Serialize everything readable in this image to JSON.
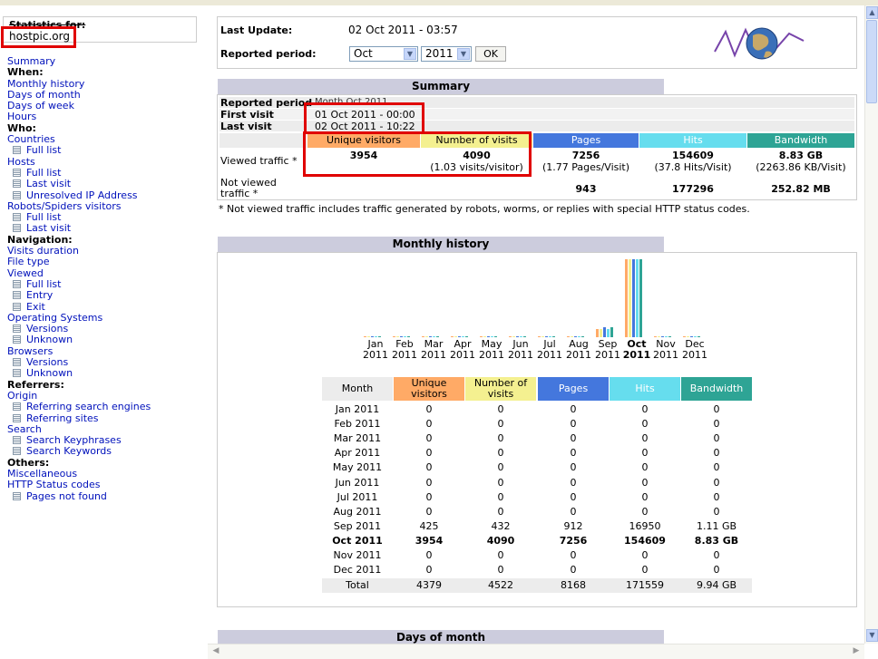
{
  "sidebar": {
    "stats_label": "Statistics for:",
    "site": "hostpic.org",
    "menu": [
      {
        "t": "link",
        "label": "Summary"
      },
      {
        "t": "head",
        "label": "When:"
      },
      {
        "t": "link",
        "label": "Monthly history"
      },
      {
        "t": "link",
        "label": "Days of month"
      },
      {
        "t": "link",
        "label": "Days of week"
      },
      {
        "t": "link",
        "label": "Hours"
      },
      {
        "t": "head",
        "label": "Who:"
      },
      {
        "t": "link",
        "label": "Countries"
      },
      {
        "t": "sub",
        "label": "Full list"
      },
      {
        "t": "link",
        "label": "Hosts"
      },
      {
        "t": "sub",
        "label": "Full list"
      },
      {
        "t": "sub",
        "label": "Last visit"
      },
      {
        "t": "sub",
        "label": "Unresolved IP Address"
      },
      {
        "t": "link",
        "label": "Robots/Spiders visitors"
      },
      {
        "t": "sub",
        "label": "Full list"
      },
      {
        "t": "sub",
        "label": "Last visit"
      },
      {
        "t": "head",
        "label": "Navigation:"
      },
      {
        "t": "link",
        "label": "Visits duration"
      },
      {
        "t": "link",
        "label": "File type"
      },
      {
        "t": "link",
        "label": "Viewed"
      },
      {
        "t": "sub",
        "label": "Full list"
      },
      {
        "t": "sub",
        "label": "Entry"
      },
      {
        "t": "sub",
        "label": "Exit"
      },
      {
        "t": "link",
        "label": "Operating Systems"
      },
      {
        "t": "sub",
        "label": "Versions"
      },
      {
        "t": "sub",
        "label": "Unknown"
      },
      {
        "t": "link",
        "label": "Browsers"
      },
      {
        "t": "sub",
        "label": "Versions"
      },
      {
        "t": "sub",
        "label": "Unknown"
      },
      {
        "t": "head",
        "label": "Referrers:"
      },
      {
        "t": "link",
        "label": "Origin"
      },
      {
        "t": "sub",
        "label": "Referring search engines"
      },
      {
        "t": "sub",
        "label": "Referring sites"
      },
      {
        "t": "link",
        "label": "Search"
      },
      {
        "t": "sub",
        "label": "Search Keyphrases"
      },
      {
        "t": "sub",
        "label": "Search Keywords"
      },
      {
        "t": "head",
        "label": "Others:"
      },
      {
        "t": "link",
        "label": "Miscellaneous"
      },
      {
        "t": "link",
        "label": "HTTP Status codes"
      },
      {
        "t": "sub",
        "label": "Pages not found"
      }
    ]
  },
  "header": {
    "last_update_label": "Last Update:",
    "last_update_value": "02 Oct 2011 - 03:57",
    "period_label": "Reported period:",
    "month_value": "Oct",
    "year_value": "2011",
    "ok_label": "OK"
  },
  "summary": {
    "title": "Summary",
    "reported_period_label": "Reported period",
    "reported_period_value": "Month Oct 2011",
    "first_visit_label": "First visit",
    "first_visit_value": "01 Oct 2011 - 00:00",
    "last_visit_label": "Last visit",
    "last_visit_value": "02 Oct 2011 - 10:22",
    "columns": [
      "Unique visitors",
      "Number of visits",
      "Pages",
      "Hits",
      "Bandwidth"
    ],
    "viewed_label": "Viewed traffic *",
    "viewed": {
      "unique": "3954",
      "visits": "4090",
      "visits_sub": "(1.03 visits/visitor)",
      "pages": "7256",
      "pages_sub": "(1.77 Pages/Visit)",
      "hits": "154609",
      "hits_sub": "(37.8 Hits/Visit)",
      "bandwidth": "8.83 GB",
      "bandwidth_sub": "(2263.86 KB/Visit)"
    },
    "not_viewed_label_1": "Not viewed",
    "not_viewed_label_2": "traffic *",
    "not_viewed": {
      "pages": "943",
      "hits": "177296",
      "bandwidth": "252.82 MB"
    },
    "note": "* Not viewed traffic includes traffic generated by robots, worms, or replies with special HTTP status codes."
  },
  "monthly": {
    "title": "Monthly history",
    "table_headers": [
      "Month",
      "Unique visitors",
      "Number of visits",
      "Pages",
      "Hits",
      "Bandwidth"
    ],
    "rows": [
      [
        "Jan 2011",
        "0",
        "0",
        "0",
        "0",
        "0"
      ],
      [
        "Feb 2011",
        "0",
        "0",
        "0",
        "0",
        "0"
      ],
      [
        "Mar 2011",
        "0",
        "0",
        "0",
        "0",
        "0"
      ],
      [
        "Apr 2011",
        "0",
        "0",
        "0",
        "0",
        "0"
      ],
      [
        "May 2011",
        "0",
        "0",
        "0",
        "0",
        "0"
      ],
      [
        "Jun 2011",
        "0",
        "0",
        "0",
        "0",
        "0"
      ],
      [
        "Jul 2011",
        "0",
        "0",
        "0",
        "0",
        "0"
      ],
      [
        "Aug 2011",
        "0",
        "0",
        "0",
        "0",
        "0"
      ],
      [
        "Sep 2011",
        "425",
        "432",
        "912",
        "16950",
        "1.11 GB"
      ],
      [
        "Oct 2011",
        "3954",
        "4090",
        "7256",
        "154609",
        "8.83 GB"
      ],
      [
        "Nov 2011",
        "0",
        "0",
        "0",
        "0",
        "0"
      ],
      [
        "Dec 2011",
        "0",
        "0",
        "0",
        "0",
        "0"
      ]
    ],
    "total": [
      "Total",
      "4379",
      "4522",
      "8168",
      "171559",
      "9.94 GB"
    ]
  },
  "chart_data": {
    "type": "bar",
    "categories": [
      "Jan 2011",
      "Feb 2011",
      "Mar 2011",
      "Apr 2011",
      "May 2011",
      "Jun 2011",
      "Jul 2011",
      "Aug 2011",
      "Sep 2011",
      "Oct 2011",
      "Nov 2011",
      "Dec 2011"
    ],
    "month_labels": [
      "Jan",
      "Feb",
      "Mar",
      "Apr",
      "May",
      "Jun",
      "Jul",
      "Aug",
      "Sep",
      "Oct",
      "Nov",
      "Dec"
    ],
    "year_label": "2011",
    "series": [
      {
        "name": "Unique visitors",
        "color": "#ffaa66",
        "values": [
          0,
          0,
          0,
          0,
          0,
          0,
          0,
          0,
          425,
          3954,
          0,
          0
        ]
      },
      {
        "name": "Number of visits",
        "color": "#f4f090",
        "values": [
          0,
          0,
          0,
          0,
          0,
          0,
          0,
          0,
          432,
          4090,
          0,
          0
        ]
      },
      {
        "name": "Pages",
        "color": "#4477dd",
        "values": [
          0,
          0,
          0,
          0,
          0,
          0,
          0,
          0,
          912,
          7256,
          0,
          0
        ]
      },
      {
        "name": "Hits",
        "color": "#66ddee",
        "values": [
          0,
          0,
          0,
          0,
          0,
          0,
          0,
          0,
          16950,
          154609,
          0,
          0
        ]
      },
      {
        "name": "Bandwidth",
        "color": "#2ea495",
        "values": [
          0,
          0,
          0,
          0,
          0,
          0,
          0,
          0,
          1.11,
          8.83,
          0,
          0
        ]
      }
    ]
  },
  "days_of_month": {
    "title": "Days of month"
  }
}
